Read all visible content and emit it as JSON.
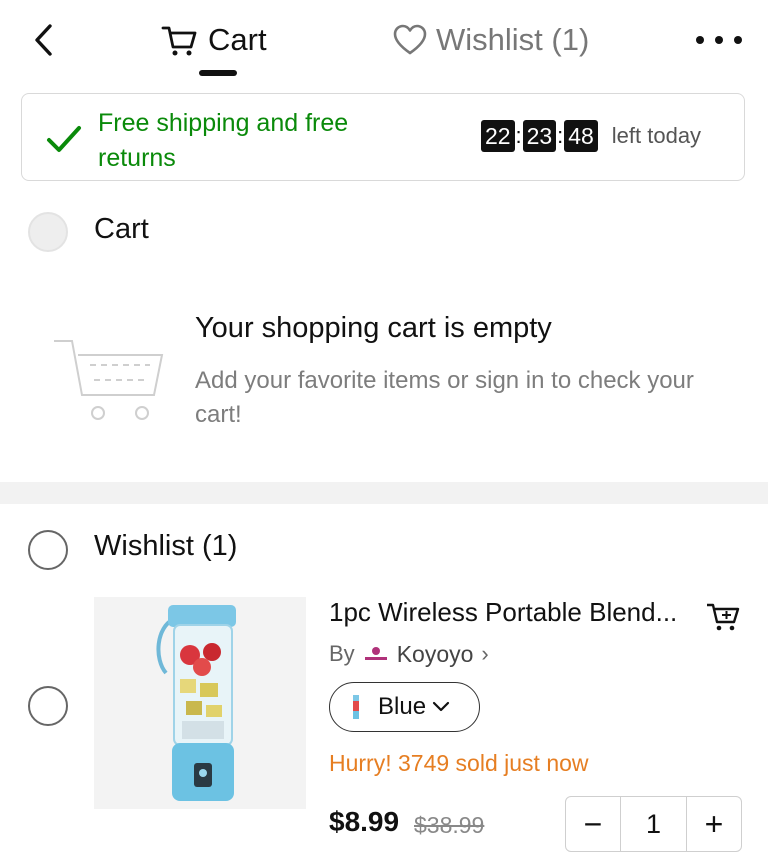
{
  "header": {
    "back_icon": "chevron-left-icon",
    "cart_tab_label": "Cart",
    "cart_tab_icon": "cart-icon",
    "wishlist_tab_label": "Wishlist (1)",
    "wishlist_tab_icon": "heart-icon",
    "more_icon": "more-dots-icon"
  },
  "promo": {
    "text": "Free shipping and free returns",
    "accent_color": "#0a8a0a",
    "timer": {
      "hours": "22",
      "minutes": "23",
      "seconds": "48",
      "suffix": "left today"
    }
  },
  "cart": {
    "title": "Cart",
    "empty_title": "Your shopping cart is empty",
    "empty_subtitle": "Add your favorite items or sign in to check your cart!"
  },
  "wishlist": {
    "title": "Wishlist (1)",
    "items": [
      {
        "name": "1pc Wireless Portable Blend...",
        "by_label": "By",
        "store": "Koyoyo",
        "store_chevron": "›",
        "variant": "Blue",
        "urgency": "Hurry! 3749 sold just now",
        "urgency_color": "#e67e22",
        "price": "$8.99",
        "original_price": "$38.99",
        "quantity": "1",
        "decrement_label": "−",
        "increment_label": "+"
      }
    ]
  }
}
